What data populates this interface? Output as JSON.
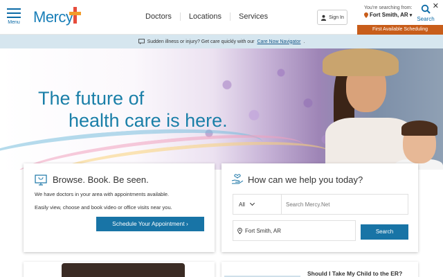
{
  "header": {
    "menu_label": "Menu",
    "logo_text": "Mercy",
    "nav": [
      "Doctors",
      "Locations",
      "Services"
    ],
    "signin_label": "Sign In",
    "searching_from": "You're searching from:",
    "location": "Fort Smith, AR",
    "search_label": "Search",
    "first_available": "First Available Scheduling"
  },
  "alert": {
    "text": "Sudden illness or injury? Get care quickly with our",
    "link": "Care Now Navigator",
    "suffix": ".",
    "close": "✕"
  },
  "hero": {
    "line1": "The future of",
    "line2": "health care is here."
  },
  "browse_card": {
    "title": "Browse. Book. Be seen.",
    "line1": "We have doctors in your area with appointments available.",
    "line2": "Easily view, choose and book video or office visits near you.",
    "button": "Schedule Your Appointment ›"
  },
  "help_card": {
    "title": "How can we help you today?",
    "filter_value": "All",
    "search_placeholder": "Search Mercy.Net",
    "location_value": "Fort Smith, AR",
    "search_button": "Search"
  },
  "bottom": {
    "right_title": "Should I Take My Child to the ER?"
  },
  "colors": {
    "brand_blue": "#1874a6",
    "accent_orange": "#c85d1a",
    "alert_bg": "#d6e6ef",
    "hero_text": "#1a7fa8"
  },
  "icons": [
    "menu-icon",
    "person-icon",
    "pin-icon",
    "search-icon",
    "message-icon",
    "close-icon",
    "monitor-stethoscope-icon",
    "helping-hand-icon",
    "chevron-down-icon"
  ]
}
